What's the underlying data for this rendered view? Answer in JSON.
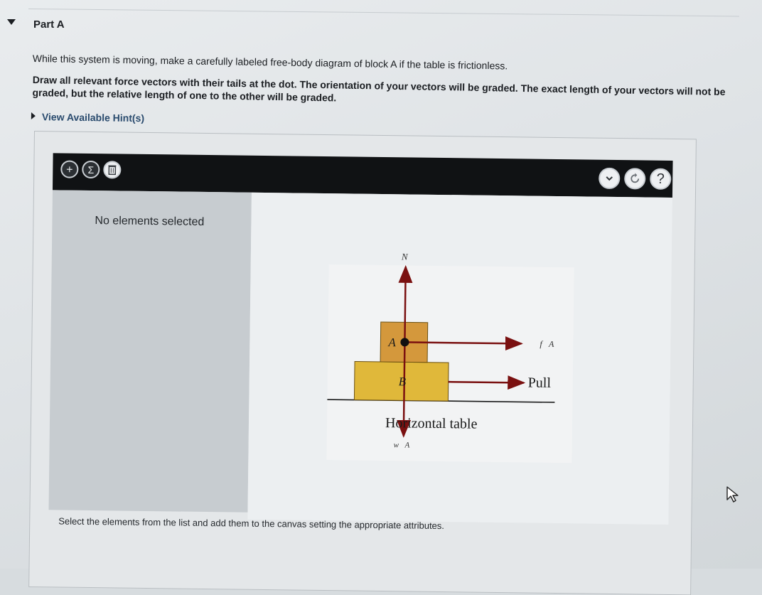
{
  "part": {
    "title": "Part A"
  },
  "question": {
    "prompt": "While this system is moving, make a carefully labeled free-body diagram of block A if the table is frictionless.",
    "instructions": "Draw all relevant force vectors with their tails at the dot. The orientation of your vectors will be graded. The exact length of your vectors will not be graded, but the relative length of one to the other will be graded."
  },
  "hint": {
    "label": "View Available Hint(s)"
  },
  "toolbar": {
    "add_icon": "plus-icon",
    "sum_icon": "sigma-icon",
    "delete_icon": "trash-icon",
    "dropdown_icon": "chevron-down-icon",
    "reset_icon": "reset-icon",
    "help_label": "?",
    "add_label": "+",
    "sum_label": "Σ"
  },
  "panel": {
    "empty_label": "No elements selected"
  },
  "diagram": {
    "normal_label": "N⃗",
    "block_a_label": "A",
    "block_b_label": "B",
    "friction_label": "f⃗A",
    "pull_label": "Pull",
    "table_label": "Horizontal table",
    "weight_label": "w⃗A",
    "colors": {
      "block_a": "#d4983c",
      "block_b": "#e0b83a",
      "arrow": "#7a1010",
      "table": "#1a1a1a"
    }
  },
  "status": {
    "text": "Select the elements from the list and add them to the canvas setting the appropriate attributes."
  }
}
